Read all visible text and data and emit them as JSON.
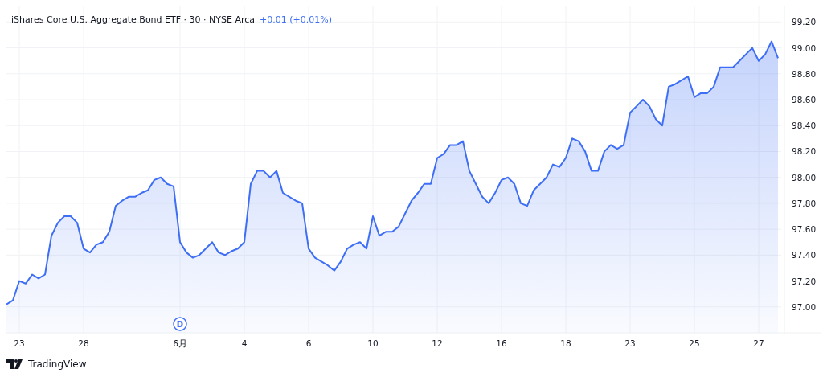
{
  "chart": {
    "title": "iShares Core U.S. Aggregate Bond ETF · 30 · NYSE Arca",
    "change": "+0.01 (+0.01%)",
    "chart_data": {
      "type": "area",
      "ylim": [
        96.8,
        99.32
      ],
      "grid": true,
      "yticks": [
        {
          "value": 97,
          "label": "97.00"
        },
        {
          "value": 97.2,
          "label": "97.20"
        },
        {
          "value": 97.4,
          "label": "97.40"
        },
        {
          "value": 97.6,
          "label": "97.60"
        },
        {
          "value": 97.8,
          "label": "97.80"
        },
        {
          "value": 98,
          "label": "98.00"
        },
        {
          "value": 98.2,
          "label": "98.20"
        },
        {
          "value": 98.4,
          "label": "98.40"
        },
        {
          "value": 98.6,
          "label": "98.60"
        },
        {
          "value": 98.8,
          "label": "98.80"
        },
        {
          "value": 99,
          "label": "99.00"
        },
        {
          "value": 99.2,
          "label": "99.20"
        }
      ],
      "categories": [
        null,
        null,
        "23",
        null,
        null,
        null,
        null,
        null,
        null,
        null,
        null,
        null,
        "28",
        null,
        null,
        null,
        null,
        null,
        null,
        null,
        null,
        null,
        null,
        null,
        null,
        null,
        null,
        "6月",
        null,
        null,
        null,
        null,
        null,
        null,
        null,
        null,
        null,
        "4",
        null,
        null,
        null,
        null,
        null,
        null,
        null,
        null,
        null,
        "6",
        null,
        null,
        null,
        null,
        null,
        null,
        null,
        null,
        null,
        "10",
        null,
        null,
        null,
        null,
        null,
        null,
        null,
        null,
        null,
        "12",
        null,
        null,
        null,
        null,
        null,
        null,
        null,
        null,
        null,
        "16",
        null,
        null,
        null,
        null,
        null,
        null,
        null,
        null,
        null,
        "18",
        null,
        null,
        null,
        null,
        null,
        null,
        null,
        null,
        null,
        "23",
        null,
        null,
        null,
        null,
        null,
        null,
        null,
        null,
        null,
        "25",
        null,
        null,
        null,
        null,
        null,
        null,
        null,
        null,
        null,
        "27",
        null,
        null,
        null
      ],
      "series": [
        {
          "color": "#3d6ef5",
          "values": [
            97.02,
            97.05,
            97.2,
            97.18,
            97.25,
            97.22,
            97.25,
            97.55,
            97.65,
            97.7,
            97.7,
            97.65,
            97.45,
            97.42,
            97.48,
            97.5,
            97.58,
            97.78,
            97.82,
            97.85,
            97.85,
            97.88,
            97.9,
            97.98,
            98.0,
            97.95,
            97.93,
            97.5,
            97.42,
            97.38,
            97.4,
            97.45,
            97.5,
            97.42,
            97.4,
            97.43,
            97.45,
            97.5,
            97.95,
            98.05,
            98.05,
            98.0,
            98.05,
            97.88,
            97.85,
            97.82,
            97.8,
            97.45,
            97.38,
            97.35,
            97.32,
            97.28,
            97.35,
            97.45,
            97.48,
            97.5,
            97.45,
            97.7,
            97.55,
            97.58,
            97.58,
            97.62,
            97.72,
            97.82,
            97.88,
            97.95,
            97.95,
            98.15,
            98.18,
            98.25,
            98.25,
            98.28,
            98.05,
            97.95,
            97.85,
            97.8,
            97.88,
            97.98,
            98.0,
            97.95,
            97.8,
            97.78,
            97.9,
            97.95,
            98.0,
            98.1,
            98.08,
            98.15,
            98.3,
            98.28,
            98.2,
            98.05,
            98.05,
            98.2,
            98.25,
            98.22,
            98.25,
            98.5,
            98.55,
            98.6,
            98.55,
            98.45,
            98.4,
            98.7,
            98.72,
            98.75,
            98.78,
            98.62,
            98.65,
            98.65,
            98.7,
            98.85,
            98.85,
            98.85,
            98.9,
            98.95,
            99.0,
            98.9,
            98.95,
            99.05,
            98.92
          ]
        }
      ],
      "annotations": [
        {
          "text": "D",
          "x": "6月"
        }
      ]
    }
  },
  "footer": {
    "brand": "TradingView"
  }
}
